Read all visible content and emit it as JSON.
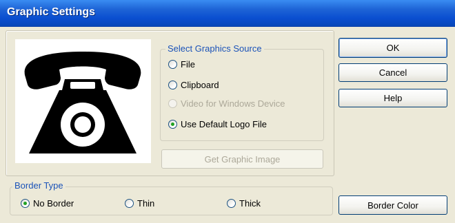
{
  "window": {
    "title": "Graphic Settings"
  },
  "source_group": {
    "label": "Select Graphics Source",
    "options": [
      {
        "label": "File",
        "checked": false,
        "enabled": true
      },
      {
        "label": "Clipboard",
        "checked": false,
        "enabled": true
      },
      {
        "label": "Video for Windows Device",
        "checked": false,
        "enabled": false
      },
      {
        "label": "Use Default Logo File",
        "checked": true,
        "enabled": true
      }
    ]
  },
  "get_image_button": {
    "label": "Get Graphic Image",
    "enabled": false
  },
  "buttons": {
    "ok": "OK",
    "cancel": "Cancel",
    "help": "Help",
    "border_color": "Border Color"
  },
  "border_group": {
    "label": "Border Type",
    "options": [
      {
        "label": "No Border",
        "checked": true
      },
      {
        "label": "Thin",
        "checked": false
      },
      {
        "label": "Thick",
        "checked": false
      }
    ]
  },
  "preview": {
    "icon": "telephone-icon"
  },
  "colors": {
    "title_bar": "#0A4ED0",
    "dialog_bg": "#ECE9D8",
    "group_label": "#1A52B8",
    "checked_radio": "#21A121"
  }
}
